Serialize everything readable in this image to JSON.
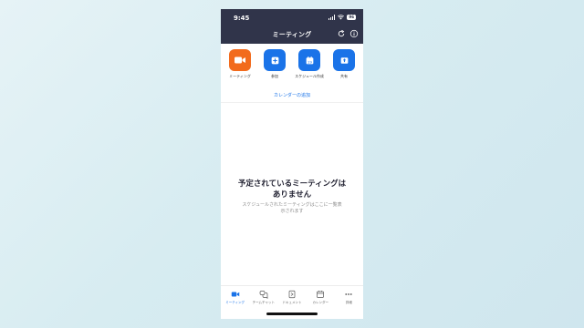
{
  "status_bar": {
    "time": "9:45",
    "battery": "96"
  },
  "header": {
    "title": "ミーティング"
  },
  "actions": [
    {
      "label": "ミーティング",
      "icon": "video-camera-icon",
      "color": "#f26b1d"
    },
    {
      "label": "参加",
      "icon": "plus-icon",
      "color": "#1a73e8"
    },
    {
      "label": "スケジュール作成",
      "icon": "calendar-icon",
      "color": "#1a73e8"
    },
    {
      "label": "共有",
      "icon": "share-up-arrow-icon",
      "color": "#1a73e8"
    }
  ],
  "calendar_link": "カレンダーの追加",
  "empty_state": {
    "title_line1": "予定されているミーティングは",
    "title_line2": "ありません",
    "desc_line1": "スケジュールされたミーティングはここに一覧表",
    "desc_line2": "示されます"
  },
  "tabs": [
    {
      "label": "ミーティング",
      "icon": "video-camera-icon",
      "active": true
    },
    {
      "label": "チームチャット",
      "icon": "chat-bubbles-icon",
      "active": false
    },
    {
      "label": "ドキュメント",
      "icon": "document-icon",
      "active": false
    },
    {
      "label": "カレンダー",
      "icon": "calendar-icon",
      "active": false
    },
    {
      "label": "詳細",
      "icon": "more-dots-icon",
      "active": false
    }
  ],
  "colors": {
    "header_bg": "#30344a",
    "accent": "#1a73e8",
    "orange": "#f26b1d"
  }
}
